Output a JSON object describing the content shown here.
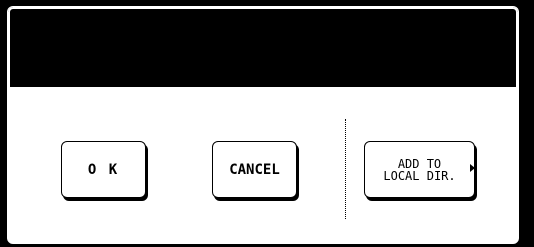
{
  "dialog": {
    "title": ""
  },
  "buttons": {
    "ok_label": "O K",
    "cancel_label": "CANCEL",
    "add_line1": "ADD TO",
    "add_line2": "LOCAL DIR."
  },
  "icons": {
    "add_button_indicator": "arrow-right-icon"
  },
  "colors": {
    "background": "#000000",
    "panel": "#ffffff",
    "text": "#000000"
  }
}
